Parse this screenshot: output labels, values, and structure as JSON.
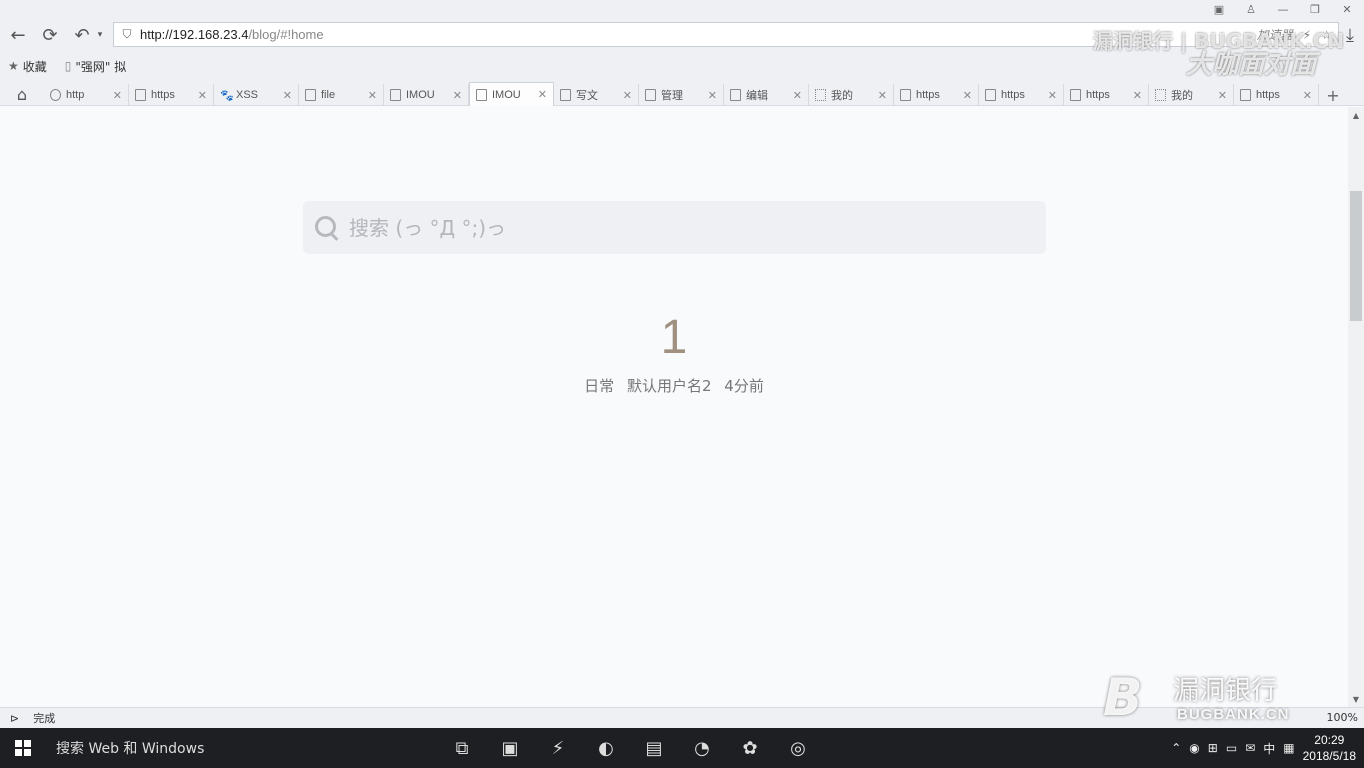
{
  "browser": {
    "url_host": "http://192.168.23.4",
    "url_path": "/blog/#!home",
    "accelerator": "加速器",
    "favorites": [
      {
        "label": "收藏"
      },
      {
        "label": "\"强网\" 拟"
      }
    ],
    "tabs": [
      {
        "label": "http"
      },
      {
        "label": "https"
      },
      {
        "label": "XSS"
      },
      {
        "label": "file"
      },
      {
        "label": "IMOU"
      },
      {
        "label": "IMOU",
        "active": true
      },
      {
        "label": "写文"
      },
      {
        "label": "管理"
      },
      {
        "label": "编辑"
      },
      {
        "label": "我的"
      },
      {
        "label": "https"
      },
      {
        "label": "https"
      },
      {
        "label": "https"
      },
      {
        "label": "我的"
      },
      {
        "label": "https"
      }
    ],
    "status": "完成",
    "zoom": "100%"
  },
  "page": {
    "search_placeholder": "搜索 (っ °Д °;)っ",
    "post_number": "1",
    "post_category": "日常",
    "post_author": "默认用户名2",
    "post_time": "4分前"
  },
  "watermark": {
    "top_text": "漏洞银行 | BUGBANK.CN",
    "top_brand": "大咖面对面",
    "bottom_cn": "漏洞银行",
    "bottom_en": "BUGBANK.CN",
    "bottom_logo": "B"
  },
  "taskbar": {
    "search_text": "搜索 Web 和 Windows",
    "ime": "中",
    "time": "20:29",
    "date": "2018/5/18"
  }
}
